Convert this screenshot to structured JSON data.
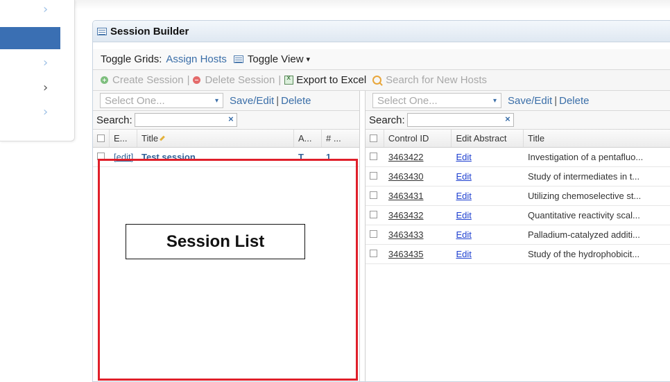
{
  "sidebar": {
    "chevrons": [
      {
        "icon": "chevron-right-icon",
        "glyph": "›",
        "color": "#9fc2e6"
      },
      {
        "icon": "chevron-right-icon",
        "glyph": "›",
        "color": "#9fc2e6"
      },
      {
        "icon": "chevron-right-icon",
        "glyph": "›",
        "color": "#555555"
      },
      {
        "icon": "chevron-right-icon",
        "glyph": "›",
        "color": "#9fc2e6"
      }
    ]
  },
  "panel": {
    "title": "Session Builder"
  },
  "toolbar1": {
    "toggle_grids_label": "Toggle Grids:",
    "assign_hosts": "Assign Hosts",
    "toggle_view": "Toggle View",
    "toggle_view_arrow": "▾"
  },
  "toolbar2": {
    "create_session": "Create Session",
    "delete_session": "Delete Session",
    "export_excel": "Export to Excel",
    "search_hosts": "Search for New Hosts",
    "separator": "|"
  },
  "left_pane": {
    "select_placeholder": "Select One...",
    "select_arrow": "▾",
    "save_edit": "Save/Edit",
    "separator": "|",
    "delete": "Delete",
    "search_label": "Search:",
    "clear_glyph": "×",
    "columns": [
      "E...",
      "Title",
      "A...",
      "# ..."
    ],
    "rows": [
      {
        "edit": "[edit]",
        "title": "Test session",
        "a": "T...",
        "count": "1"
      }
    ]
  },
  "right_pane": {
    "select_placeholder": "Select One...",
    "select_arrow": "▾",
    "save_edit": "Save/Edit",
    "separator": "|",
    "delete": "Delete",
    "search_label": "Search:",
    "clear_glyph": "×",
    "columns": [
      "Control ID",
      "Edit Abstract",
      "Title"
    ],
    "rows": [
      {
        "id": "3463422",
        "edit": "Edit",
        "title": "Investigation of a pentafluo..."
      },
      {
        "id": "3463430",
        "edit": "Edit",
        "title": "Study of intermediates in t..."
      },
      {
        "id": "3463431",
        "edit": "Edit",
        "title": "Utilizing chemoselective st..."
      },
      {
        "id": "3463432",
        "edit": "Edit",
        "title": "Quantitative reactivity scal..."
      },
      {
        "id": "3463433",
        "edit": "Edit",
        "title": "Palladium-catalyzed additi..."
      },
      {
        "id": "3463435",
        "edit": "Edit",
        "title": "Study of the hydrophobicit..."
      }
    ]
  },
  "annotation": {
    "label": "Session List",
    "color": "#e01f2a"
  }
}
